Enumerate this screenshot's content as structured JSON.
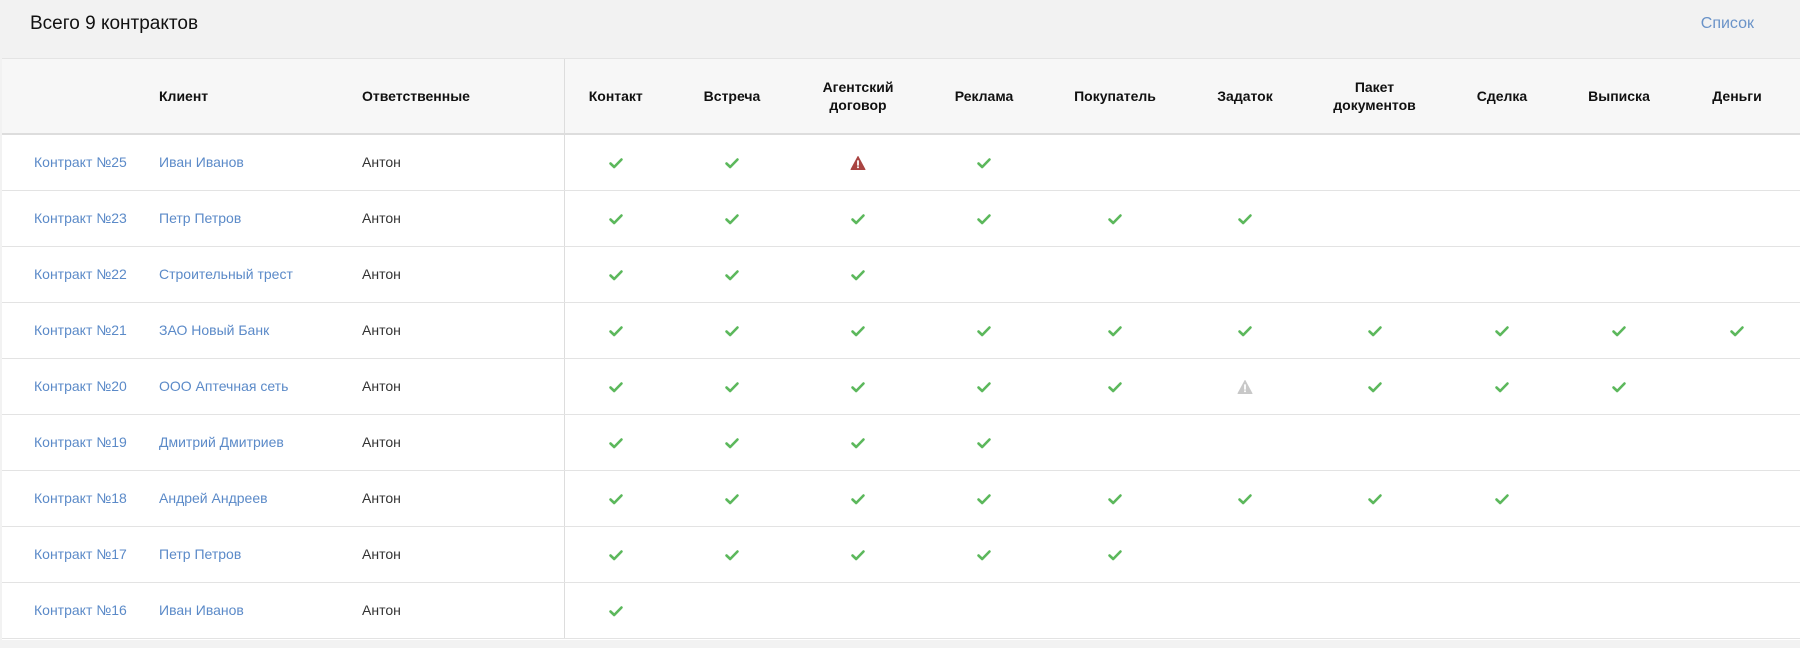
{
  "header": {
    "title": "Всего 9 контрактов",
    "list_link": "Список"
  },
  "colors": {
    "check": "#5cb85c",
    "warning": "#a94442",
    "warning_muted": "#c8c8c8",
    "link": "#5b8ac8"
  },
  "columns": {
    "client": "Клиент",
    "responsible": "Ответственные",
    "stages": [
      [
        "Контакт"
      ],
      [
        "Встреча"
      ],
      [
        "Агентский",
        "договор"
      ],
      [
        "Реклама"
      ],
      [
        "Покупатель"
      ],
      [
        "Задаток"
      ],
      [
        "Пакет",
        "документов"
      ],
      [
        "Сделка"
      ],
      [
        "Выписка"
      ],
      [
        "Деньги"
      ]
    ]
  },
  "rows": [
    {
      "contract": "Контракт №25",
      "client": "Иван Иванов",
      "responsible": "Антон",
      "stages": [
        "check",
        "check",
        "warning",
        "check",
        "",
        "",
        "",
        "",
        "",
        ""
      ]
    },
    {
      "contract": "Контракт №23",
      "client": "Петр Петров",
      "responsible": "Антон",
      "stages": [
        "check",
        "check",
        "check",
        "check",
        "check",
        "check",
        "",
        "",
        "",
        ""
      ]
    },
    {
      "contract": "Контракт №22",
      "client": "Строительный трест",
      "responsible": "Антон",
      "stages": [
        "check",
        "check",
        "check",
        "",
        "",
        "",
        "",
        "",
        "",
        ""
      ]
    },
    {
      "contract": "Контракт №21",
      "client": "ЗАО Новый Банк",
      "responsible": "Антон",
      "stages": [
        "check",
        "check",
        "check",
        "check",
        "check",
        "check",
        "check",
        "check",
        "check",
        "check"
      ]
    },
    {
      "contract": "Контракт №20",
      "client": "ООО Аптечная сеть",
      "responsible": "Антон",
      "stages": [
        "check",
        "check",
        "check",
        "check",
        "check",
        "warning-muted",
        "check",
        "check",
        "check",
        ""
      ]
    },
    {
      "contract": "Контракт №19",
      "client": "Дмитрий Дмитриев",
      "responsible": "Антон",
      "stages": [
        "check",
        "check",
        "check",
        "check",
        "",
        "",
        "",
        "",
        "",
        ""
      ]
    },
    {
      "contract": "Контракт №18",
      "client": "Андрей Андреев",
      "responsible": "Антон",
      "stages": [
        "check",
        "check",
        "check",
        "check",
        "check",
        "check",
        "check",
        "check",
        "",
        ""
      ]
    },
    {
      "contract": "Контракт №17",
      "client": "Петр Петров",
      "responsible": "Антон",
      "stages": [
        "check",
        "check",
        "check",
        "check",
        "check",
        "",
        "",
        "",
        "",
        ""
      ]
    },
    {
      "contract": "Контракт №16",
      "client": "Иван Иванов",
      "responsible": "Антон",
      "stages": [
        "check",
        "",
        "",
        "",
        "",
        "",
        "",
        "",
        "",
        ""
      ]
    }
  ]
}
